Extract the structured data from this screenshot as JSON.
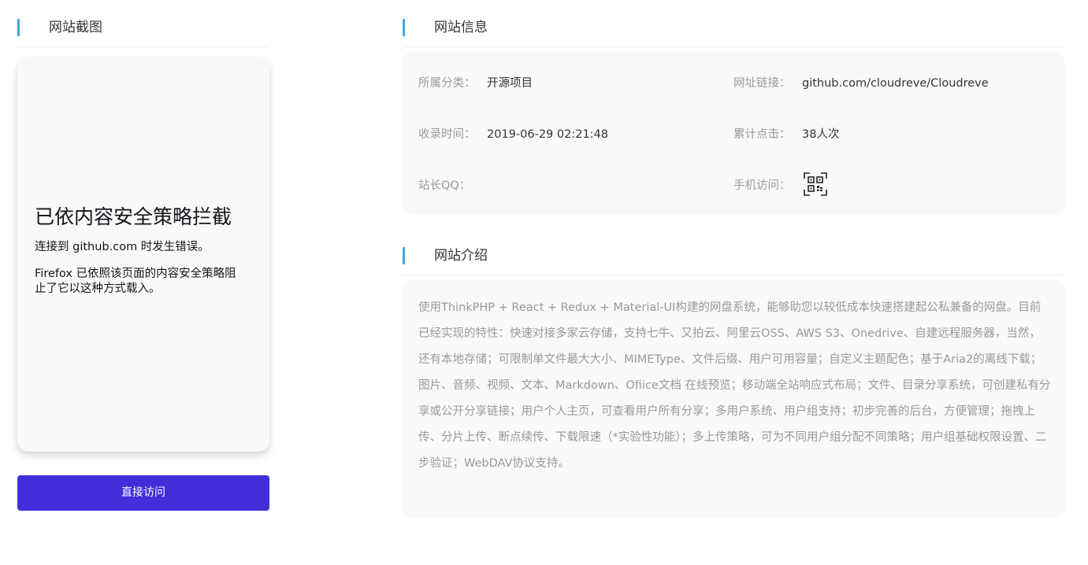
{
  "colors": {
    "accent_bar": "#3fa9dd",
    "button_bg": "#422dd9",
    "card_bg": "#f9f9f9"
  },
  "screenshot_section": {
    "title": "网站截图",
    "error_title": "已依内容安全策略拦截",
    "error_line1": "连接到 github.com 时发生错误。",
    "error_line2": "Firefox 已依照该页面的内容安全策略阻止了它以这种方式载入。",
    "visit_button": "直接访问"
  },
  "info_section": {
    "title": "网站信息",
    "fields": [
      {
        "label": "所属分类：",
        "value": "开源项目"
      },
      {
        "label": "网址链接：",
        "value": "github.com/cloudreve/Cloudreve"
      },
      {
        "label": "收录时间：",
        "value": "2019-06-29 02:21:48"
      },
      {
        "label": "累计点击：",
        "value": "38人次"
      },
      {
        "label": "站长QQ：",
        "value": ""
      },
      {
        "label": "手机访问：",
        "icon": "qr-code-icon"
      }
    ]
  },
  "intro_section": {
    "title": "网站介绍",
    "text": "使用ThinkPHP + React + Redux + Material-UI构建的网盘系统，能够助您以较低成本快速搭建起公私兼备的网盘。目前已经实现的特性：快速对接多家云存储，支持七牛、又拍云、阿里云OSS、AWS S3、Onedrive、自建远程服务器，当然，还有本地存储；可限制单文件最大大小、MIMEType、文件后缀、用户可用容量；自定义主题配色；基于Aria2的离线下载；图片、音频、视频、文本、Markdown、Ofiice文档 在线预览；移动端全站响应式布局；文件、目录分享系统，可创建私有分享或公开分享链接；用户个人主页，可查看用户所有分享；多用户系统、用户组支持；初步完善的后台，方便管理；拖拽上传、分片上传、断点续传、下载限速（*实验性功能）；多上传策略，可为不同用户组分配不同策略；用户组基础权限设置、二步验证；WebDAV协议支持。"
  }
}
